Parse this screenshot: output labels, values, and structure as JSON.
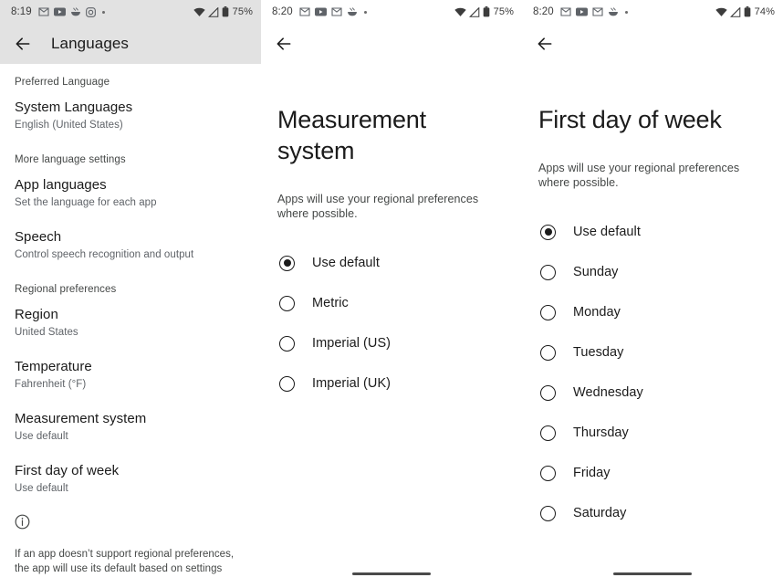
{
  "panels": {
    "languages": {
      "status_bar": {
        "time": "8:19",
        "notification_icons": [
          "gmail-icon",
          "youtube-icon",
          "food-icon",
          "instagram-icon",
          "more-dot-icon"
        ],
        "wifi_icon": "wifi-icon",
        "signal_icon": "cell-signal-icon",
        "battery_icon": "battery-icon",
        "battery_percent": "75%"
      },
      "appbar": {
        "back_icon": "back-arrow-icon",
        "title": "Languages"
      },
      "sections": [
        {
          "label": "Preferred Language",
          "items": [
            {
              "title": "System Languages",
              "subtitle": "English (United States)"
            }
          ]
        },
        {
          "label": "More language settings",
          "items": [
            {
              "title": "App languages",
              "subtitle": "Set the language for each app"
            },
            {
              "title": "Speech",
              "subtitle": "Control speech recognition and output"
            }
          ]
        },
        {
          "label": "Regional preferences",
          "items": [
            {
              "title": "Region",
              "subtitle": "United States"
            },
            {
              "title": "Temperature",
              "subtitle": "Fahrenheit (°F)"
            },
            {
              "title": "Measurement system",
              "subtitle": "Use default"
            },
            {
              "title": "First day of week",
              "subtitle": "Use default"
            }
          ]
        }
      ],
      "footer": {
        "icon": "info-icon",
        "text": "If an app doesn’t support regional preferences, the app will use its default based on settings"
      }
    },
    "measurement_system": {
      "status_bar": {
        "time": "8:20",
        "notification_icons": [
          "gmail-icon",
          "youtube-icon",
          "gmail-icon",
          "food-icon",
          "more-dot-icon"
        ],
        "wifi_icon": "wifi-icon",
        "signal_icon": "cell-signal-icon",
        "battery_icon": "battery-icon",
        "battery_percent": "75%"
      },
      "appbar": {
        "back_icon": "back-arrow-icon",
        "title": ""
      },
      "title": "Measurement system",
      "description": "Apps will use your regional preferences where possible.",
      "options": [
        {
          "label": "Use default",
          "selected": true
        },
        {
          "label": "Metric",
          "selected": false
        },
        {
          "label": "Imperial (US)",
          "selected": false
        },
        {
          "label": "Imperial (UK)",
          "selected": false
        }
      ]
    },
    "first_day_of_week": {
      "status_bar": {
        "time": "8:20",
        "notification_icons": [
          "gmail-icon",
          "youtube-icon",
          "gmail-icon",
          "food-icon",
          "more-dot-icon"
        ],
        "wifi_icon": "wifi-icon",
        "signal_icon": "cell-signal-icon",
        "battery_icon": "battery-icon",
        "battery_percent": "74%"
      },
      "appbar": {
        "back_icon": "back-arrow-icon",
        "title": ""
      },
      "title": "First day of week",
      "description": "Apps will use your regional preferences where possible.",
      "options": [
        {
          "label": "Use default",
          "selected": true
        },
        {
          "label": "Sunday",
          "selected": false
        },
        {
          "label": "Monday",
          "selected": false
        },
        {
          "label": "Tuesday",
          "selected": false
        },
        {
          "label": "Wednesday",
          "selected": false
        },
        {
          "label": "Thursday",
          "selected": false
        },
        {
          "label": "Friday",
          "selected": false
        },
        {
          "label": "Saturday",
          "selected": false
        }
      ]
    }
  },
  "colors": {
    "appbar_tint": "#e2e2e2",
    "primary_text": "#1b1b1b",
    "secondary_text": "#444746",
    "background": "#ffffff"
  }
}
